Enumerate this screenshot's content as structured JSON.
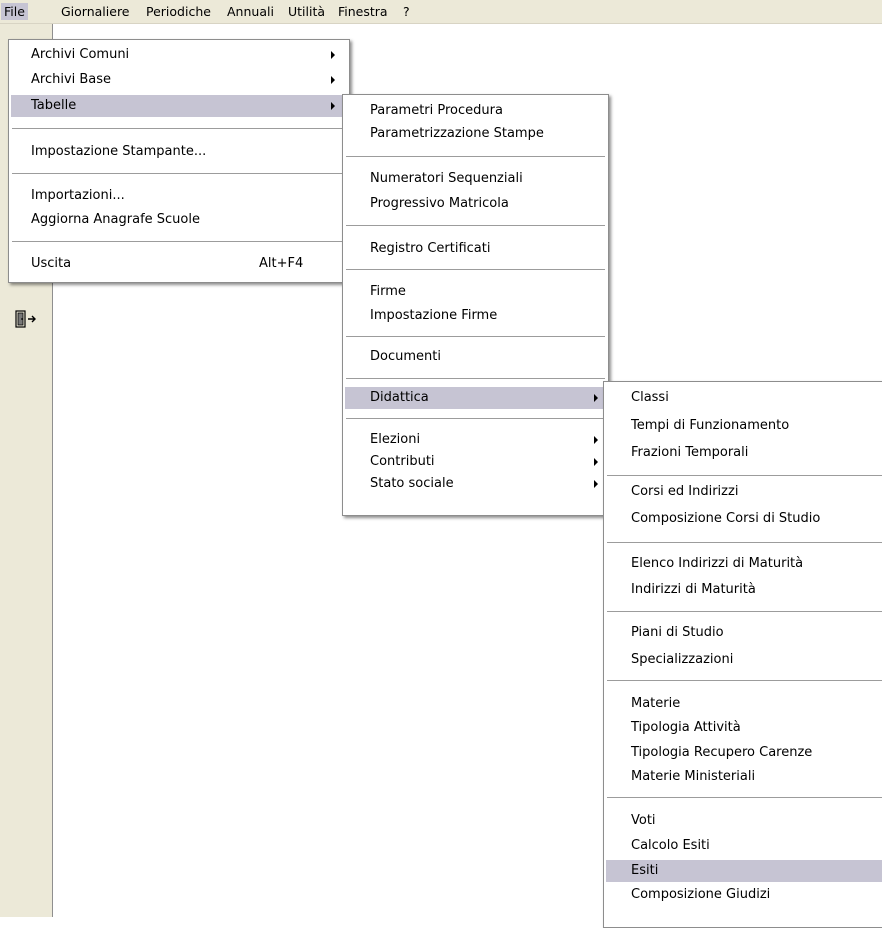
{
  "menubar": {
    "items": [
      "File",
      "Giornaliere",
      "Periodiche",
      "Annuali",
      "Utilità",
      "Finestra",
      "?"
    ]
  },
  "toolbar": {
    "icons": [
      "exit-door-icon"
    ]
  },
  "file_menu": {
    "items": [
      {
        "label": "Archivi Comuni",
        "submenu": true
      },
      {
        "label": "Archivi Base",
        "submenu": true
      },
      {
        "label": "Tabelle",
        "submenu": true,
        "highlighted": true
      },
      {
        "label": "Impostazione Stampante..."
      },
      {
        "label": "Importazioni..."
      },
      {
        "label": "Aggiorna Anagrafe Scuole"
      },
      {
        "label": "Uscita",
        "shortcut": "Alt+F4"
      }
    ]
  },
  "tabelle_menu": {
    "items": [
      {
        "label": "Parametri Procedura"
      },
      {
        "label": "Parametrizzazione Stampe"
      },
      {
        "label": "Numeratori Sequenziali"
      },
      {
        "label": "Progressivo Matricola"
      },
      {
        "label": "Registro Certificati"
      },
      {
        "label": "Firme"
      },
      {
        "label": "Impostazione Firme"
      },
      {
        "label": "Documenti"
      },
      {
        "label": "Didattica",
        "submenu": true,
        "highlighted": true
      },
      {
        "label": "Elezioni",
        "submenu": true
      },
      {
        "label": "Contributi",
        "submenu": true
      },
      {
        "label": "Stato sociale",
        "submenu": true
      }
    ]
  },
  "didattica_menu": {
    "items": [
      {
        "label": "Classi"
      },
      {
        "label": "Tempi di Funzionamento"
      },
      {
        "label": "Frazioni Temporali"
      },
      {
        "label": "Corsi ed Indirizzi"
      },
      {
        "label": "Composizione Corsi di Studio"
      },
      {
        "label": "Elenco Indirizzi di Maturità"
      },
      {
        "label": "Indirizzi di Maturità"
      },
      {
        "label": "Piani di Studio"
      },
      {
        "label": "Specializzazioni"
      },
      {
        "label": "Materie"
      },
      {
        "label": "Tipologia Attività"
      },
      {
        "label": "Tipologia Recupero Carenze"
      },
      {
        "label": "Materie Ministeriali"
      },
      {
        "label": "Voti"
      },
      {
        "label": "Calcolo Esiti"
      },
      {
        "label": "Esiti",
        "highlighted": true
      },
      {
        "label": "Composizione Giudizi"
      }
    ]
  },
  "colors": {
    "highlight": "#c6c4d3",
    "menubar_bg": "#ece9d8",
    "menu_bg": "#ffffff"
  }
}
